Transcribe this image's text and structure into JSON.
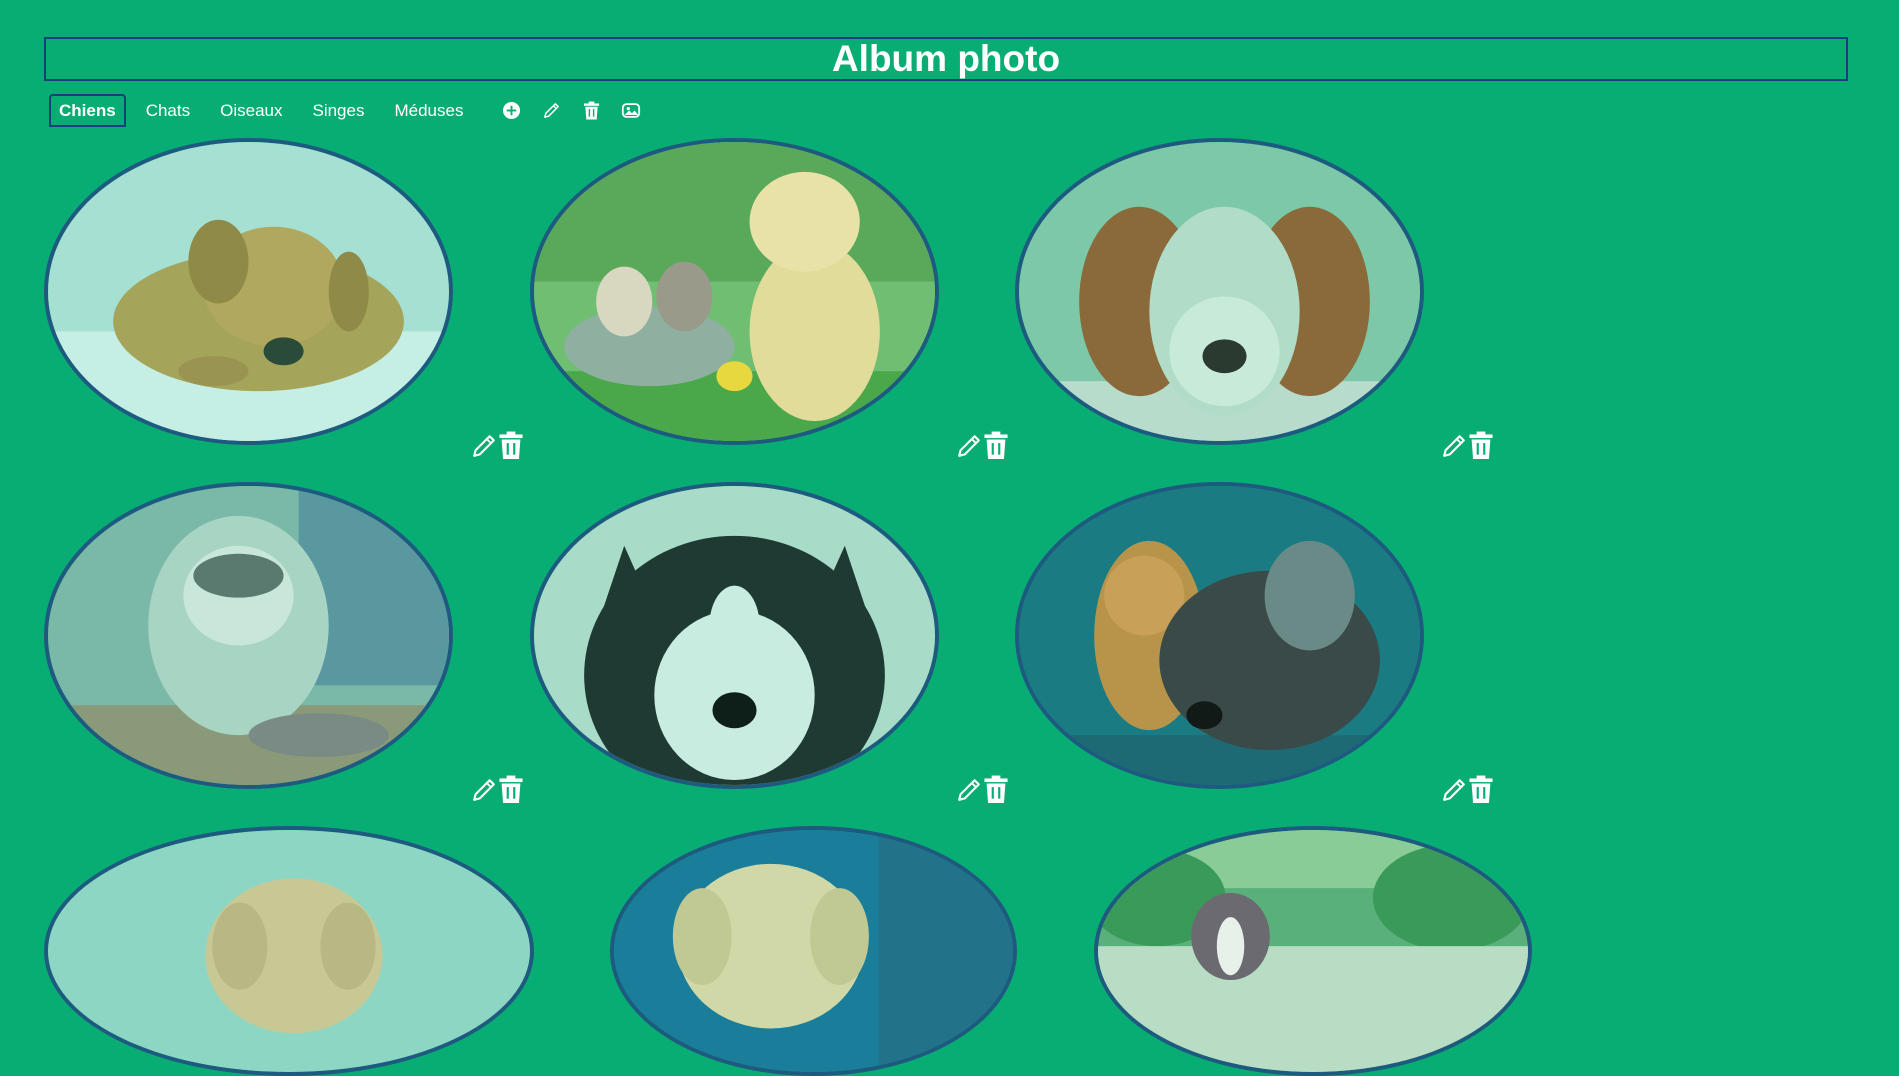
{
  "header": {
    "title": "Album photo"
  },
  "tabs": [
    {
      "label": "Chiens",
      "active": true
    },
    {
      "label": "Chats",
      "active": false
    },
    {
      "label": "Oiseaux",
      "active": false
    },
    {
      "label": "Singes",
      "active": false
    },
    {
      "label": "Méduses",
      "active": false
    }
  ],
  "toolbar_icons": [
    "add-circle-icon",
    "pencil-icon",
    "trash-icon",
    "photo-frame-icon"
  ],
  "photos": [
    {
      "subject": "sleeping golden puppy"
    },
    {
      "subject": "golden retriever puppy with kittens in a tub"
    },
    {
      "subject": "cavalier king charles spaniel puppy"
    },
    {
      "subject": "husky puppy with tabby kitten"
    },
    {
      "subject": "blue-eyed siberian husky"
    },
    {
      "subject": "orange kitten with shaggy grey dog"
    },
    {
      "subject": "golden retriever puppy"
    },
    {
      "subject": "golden retriever puppy"
    },
    {
      "subject": "australian shepherd puppy in a garden"
    }
  ],
  "colors": {
    "background": "#08ad73",
    "border": "#1a3d7c",
    "photo_border": "#1e5a80",
    "icon": "#ffffff"
  }
}
